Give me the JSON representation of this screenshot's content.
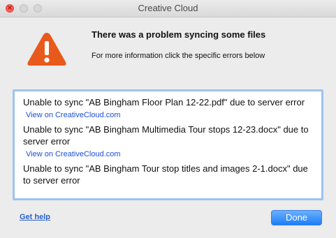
{
  "window": {
    "title": "Creative Cloud",
    "close_glyph": "×"
  },
  "dialog": {
    "heading": "There was a problem syncing some files",
    "subheading": "For more information click the specific errors below",
    "icon": "warning-triangle-icon",
    "icon_color": "#e85a1b"
  },
  "errors": [
    {
      "message": "Unable to sync \"AB Bingham Floor Plan 12-22.pdf\" due to server error",
      "link": "View on CreativeCloud.com"
    },
    {
      "message": "Unable to sync \"AB Bingham Multimedia Tour stops 12-23.docx\" due to server error",
      "link": "View on CreativeCloud.com"
    },
    {
      "message": "Unable to sync \"AB Bingham Tour stop titles and images 2-1.docx\" due to server error",
      "link": ""
    }
  ],
  "footer": {
    "help_label": "Get help",
    "done_label": "Done"
  },
  "colors": {
    "accent": "#1d7ef5",
    "link": "#1a4fd6",
    "box_border": "#9cc3f0"
  }
}
